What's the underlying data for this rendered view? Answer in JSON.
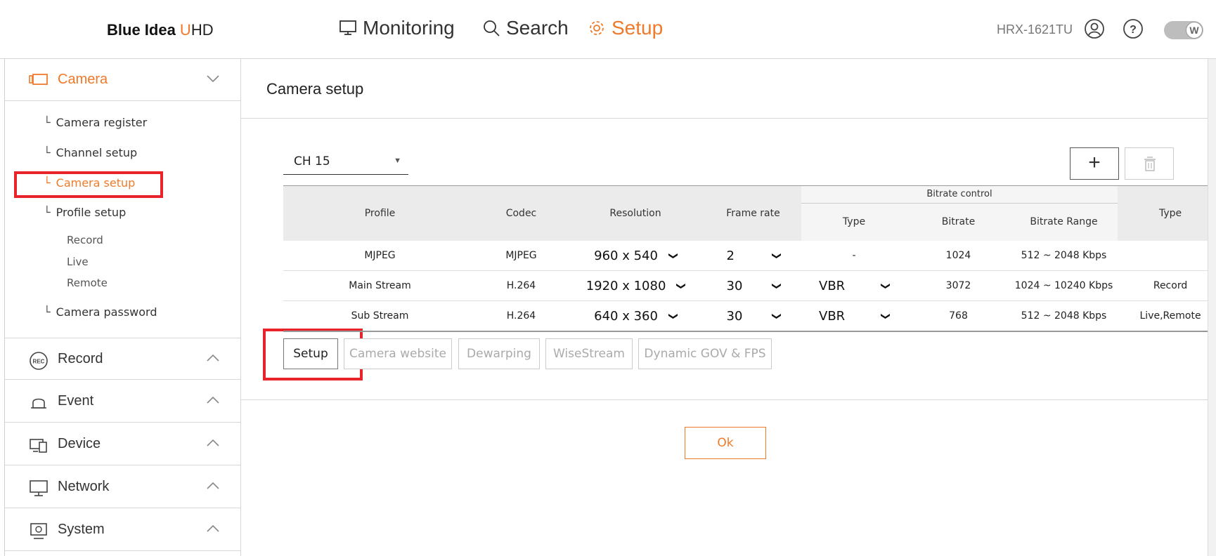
{
  "header": {
    "brand_main": "Blue Idea ",
    "brand_u": "U",
    "brand_hd": "HD",
    "nav": {
      "monitoring": "Monitoring",
      "search": "Search",
      "setup": "Setup"
    },
    "model": "HRX-1621TU",
    "toggle_label": "W"
  },
  "sidebar": {
    "camera": "Camera",
    "items": {
      "camera_register": "Camera register",
      "channel_setup": "Channel setup",
      "camera_setup": "Camera setup",
      "profile_setup": "Profile setup",
      "record": "Record",
      "live": "Live",
      "remote": "Remote",
      "camera_password": "Camera password"
    },
    "sections": {
      "record": "Record",
      "event": "Event",
      "device": "Device",
      "network": "Network",
      "system": "System"
    },
    "rec_badge": "REC"
  },
  "main": {
    "title": "Camera setup",
    "channel": "CH 15",
    "add_label": "+",
    "table": {
      "headers": {
        "profile": "Profile",
        "codec": "Codec",
        "resolution": "Resolution",
        "frame_rate": "Frame rate",
        "bitrate_control": "Bitrate control",
        "bc_type": "Type",
        "bitrate": "Bitrate",
        "bitrate_range": "Bitrate Range",
        "type": "Type"
      },
      "rows": [
        {
          "profile": "MJPEG",
          "codec": "MJPEG",
          "resolution": "960 x 540",
          "frame_rate": "2",
          "bc_type": "-",
          "bitrate": "1024",
          "range": "512 ~ 2048 Kbps",
          "type": ""
        },
        {
          "profile": "Main Stream",
          "codec": "H.264",
          "resolution": "1920 x 1080",
          "frame_rate": "30",
          "bc_type": "VBR",
          "bitrate": "3072",
          "range": "1024 ~ 10240 Kbps",
          "type": "Record"
        },
        {
          "profile": "Sub Stream",
          "codec": "H.264",
          "resolution": "640 x 360",
          "frame_rate": "30",
          "bc_type": "VBR",
          "bitrate": "768",
          "range": "512 ~ 2048 Kbps",
          "type": "Live,Remote"
        }
      ]
    },
    "buttons": {
      "setup": "Setup",
      "camera_website": "Camera website",
      "dewarping": "Dewarping",
      "wisestream": "WiseStream",
      "dynamic": "Dynamic GOV & FPS"
    },
    "ok": "Ok"
  },
  "colors": {
    "accent": "#f07a2a",
    "highlight": "#e8232a"
  }
}
